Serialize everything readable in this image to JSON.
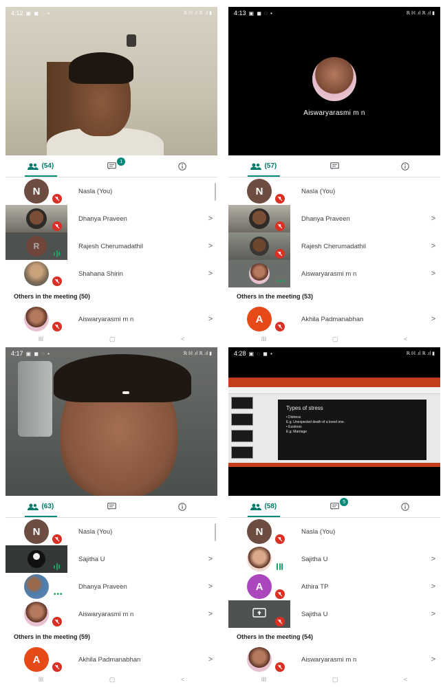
{
  "panels": [
    {
      "status_time": "4:12",
      "status_icons": "▣ ◼ ◌ •",
      "status_right": "ℝ ℍ .ıl ℝ .ıl ▮",
      "tabs": {
        "people_count": "(54)",
        "chat_badge": "1"
      },
      "participants": [
        {
          "name": "Nasla (You)",
          "avatar_letter": "N",
          "avatar_color": "#6d4c41",
          "audio": "muted"
        },
        {
          "name": "Dhanya Praveen",
          "thumb": "video",
          "audio": "muted"
        },
        {
          "name": "Rajesh Cherumadathil",
          "avatar_letter": "R",
          "avatar_color": "#8d3b2a",
          "thumb": "video-dark",
          "audio": "speaking"
        },
        {
          "name": "Shahana Shirin",
          "thumb": "photo",
          "audio": "muted"
        }
      ],
      "others_label": "Others in the meeting (50)",
      "others": [
        {
          "name": "Aiswaryarasmi m n",
          "thumb": "photo",
          "audio": "muted"
        }
      ]
    },
    {
      "status_time": "4:13",
      "status_icons": "▣ ◼ ◌ •",
      "status_right": "ℝ ℍ .ıl ℝ .ıl ▮",
      "stage_name": "Aiswaryarasmi m n",
      "tabs": {
        "people_count": "(57)"
      },
      "participants": [
        {
          "name": "Nasla (You)",
          "avatar_letter": "N",
          "avatar_color": "#6d4c41",
          "audio": "muted"
        },
        {
          "name": "Dhanya Praveen",
          "thumb": "video",
          "audio": "muted"
        },
        {
          "name": "Rajesh Cherumadathil",
          "thumb": "video",
          "audio": "muted"
        },
        {
          "name": "Aiswaryarasmi m n",
          "thumb": "photo",
          "audio": "dots"
        }
      ],
      "others_label": "Others in the meeting (53)",
      "others": [
        {
          "name": "Akhila Padmanabhan",
          "avatar_letter": "A",
          "avatar_color": "#e64a19",
          "audio": "muted"
        }
      ]
    },
    {
      "status_time": "4:17",
      "status_icons": "▣ ◼ ◌ •",
      "status_right": "ℝ ℍ .ıl ℝ .ıl ▮",
      "tabs": {
        "people_count": "(63)"
      },
      "participants": [
        {
          "name": "Nasla (You)",
          "avatar_letter": "N",
          "avatar_color": "#6d4c41",
          "audio": "muted"
        },
        {
          "name": "Sajitha U",
          "thumb": "video-dark",
          "audio": "speaking"
        },
        {
          "name": "Dhanya Praveen",
          "thumb": "photo",
          "audio": "dots"
        },
        {
          "name": "Aiswaryarasmi m n",
          "thumb": "photo",
          "audio": "muted"
        }
      ],
      "others_label": "Others in the meeting (59)",
      "others": [
        {
          "name": "Akhila Padmanabhan",
          "avatar_letter": "A",
          "avatar_color": "#e64a19",
          "audio": "muted"
        }
      ]
    },
    {
      "status_time": "4:28",
      "status_icons": "▣ ◌ ◼ •",
      "status_right": "ℝ ℍ .ıl ℝ .ıl ▮",
      "slide": {
        "title": "Types of stress",
        "lines": [
          "• Distress",
          "E.g. Unexpected death of a loved one.",
          "• Eustress",
          "E.g. Marriage"
        ]
      },
      "tabs": {
        "people_count": "(58)",
        "chat_badge": "5"
      },
      "participants": [
        {
          "name": "Nasla (You)",
          "avatar_letter": "N",
          "avatar_color": "#6d4c41",
          "audio": "muted"
        },
        {
          "name": "Sajitha U",
          "thumb": "photo",
          "audio": "speaking"
        },
        {
          "name": "Athira TP",
          "avatar_letter": "A",
          "avatar_color": "#ab47bc",
          "audio": "muted"
        },
        {
          "name": "Sajitha U",
          "thumb": "presenting",
          "audio": "muted"
        }
      ],
      "others_label": "Others in the meeting (54)",
      "others": [
        {
          "name": "Aiswaryarasmi m n",
          "thumb": "photo",
          "audio": "muted"
        }
      ]
    }
  ],
  "nav": {
    "recent": "III",
    "home": "▢",
    "back": "<"
  },
  "row_chevron": ">",
  "colors": {
    "accent": "#00897b",
    "muted": "#d93025",
    "speaking": "#1ea362"
  }
}
